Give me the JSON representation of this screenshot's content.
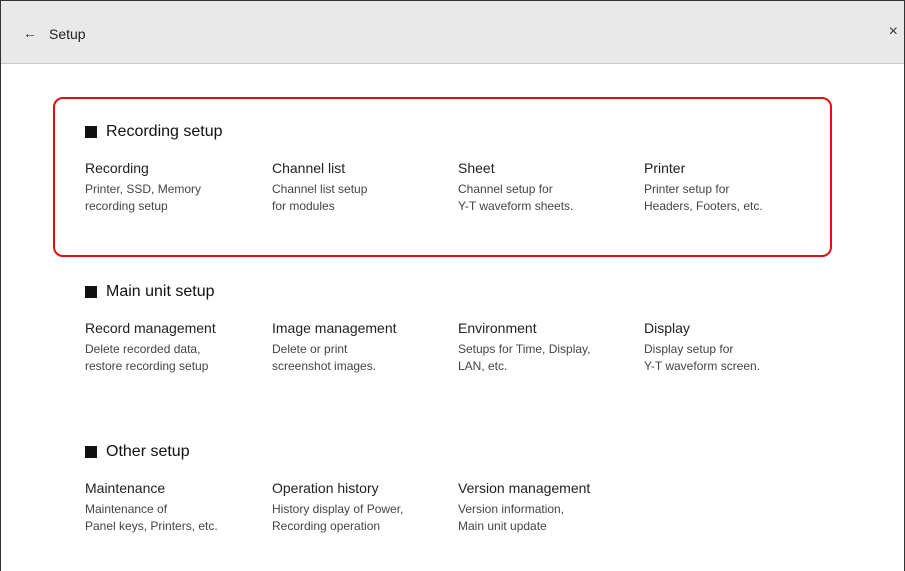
{
  "header": {
    "back_glyph": "←",
    "title": "Setup",
    "close_glyph": "×"
  },
  "highlight_color": "#e01010",
  "sections": [
    {
      "title": "Recording setup",
      "items": [
        {
          "name": "Recording",
          "desc": "Printer, SSD, Memory\nrecording setup"
        },
        {
          "name": "Channel list",
          "desc": "Channel list setup\nfor modules"
        },
        {
          "name": "Sheet",
          "desc": "Channel setup for\nY-T waveform sheets."
        },
        {
          "name": "Printer",
          "desc": "Printer setup for\nHeaders, Footers, etc."
        }
      ]
    },
    {
      "title": "Main unit setup",
      "items": [
        {
          "name": "Record management",
          "desc": "Delete recorded data,\nrestore recording setup"
        },
        {
          "name": "Image management",
          "desc": "Delete or print\nscreenshot images."
        },
        {
          "name": "Environment",
          "desc": "Setups for Time, Display,\nLAN, etc."
        },
        {
          "name": "Display",
          "desc": "Display setup for\nY-T waveform screen."
        }
      ]
    },
    {
      "title": "Other setup",
      "items": [
        {
          "name": "Maintenance",
          "desc": "Maintenance of\nPanel keys, Printers, etc."
        },
        {
          "name": "Operation history",
          "desc": "History display of Power,\nRecording operation"
        },
        {
          "name": "Version management",
          "desc": "Version information,\nMain unit update"
        }
      ]
    }
  ]
}
